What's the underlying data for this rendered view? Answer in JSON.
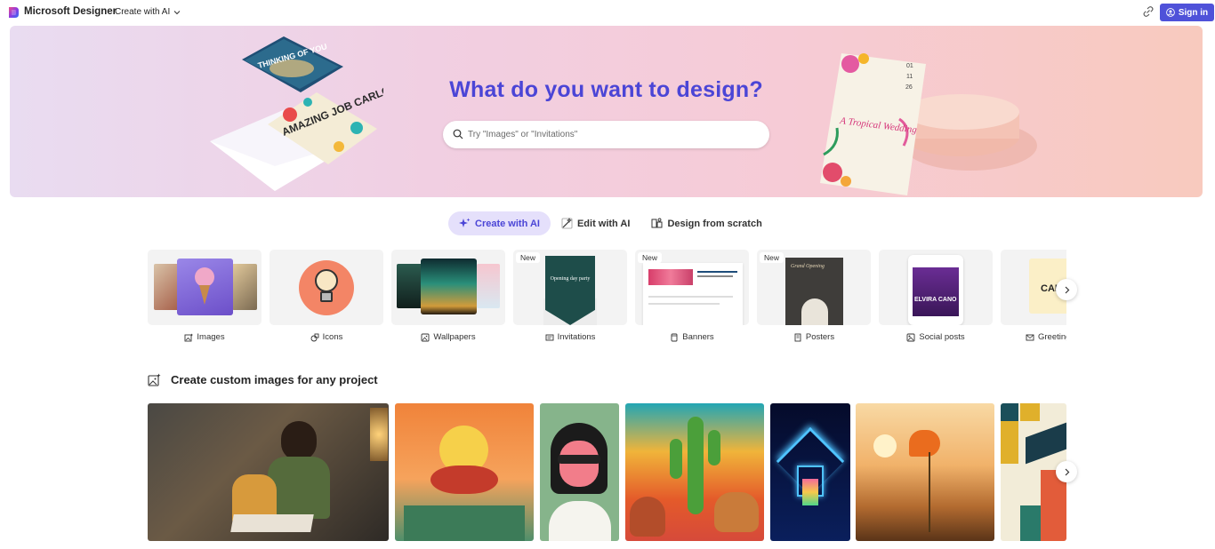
{
  "app": {
    "brand": "Microsoft Designer"
  },
  "header": {
    "create_menu_label": "Create with AI",
    "signin_label": "Sign in"
  },
  "hero": {
    "title": "What do you want to design?",
    "search_placeholder": "Try \"Images\" or \"Invitations\"",
    "card_text_1": "THINKING OF YOU",
    "card_text_2": "AMAZING JOB CARLOS",
    "invite_title": "A Tropical Wedding",
    "invite_date": [
      "01",
      "11",
      "26"
    ]
  },
  "mode_tabs": [
    {
      "label": "Create with AI",
      "icon": "sparkle-icon",
      "active": true
    },
    {
      "label": "Edit with AI",
      "icon": "magic-wand-icon",
      "active": false
    },
    {
      "label": "Design from scratch",
      "icon": "layout-icon",
      "active": false
    }
  ],
  "categories": [
    {
      "label": "Images",
      "icon": "image-sparkle-icon",
      "badge": ""
    },
    {
      "label": "Icons",
      "icon": "icon-shapes-icon",
      "badge": ""
    },
    {
      "label": "Wallpapers",
      "icon": "wallpaper-icon",
      "badge": ""
    },
    {
      "label": "Invitations",
      "icon": "invitation-icon",
      "badge": "New",
      "card_text": "Opening day party"
    },
    {
      "label": "Banners",
      "icon": "banner-icon",
      "badge": "New"
    },
    {
      "label": "Posters",
      "icon": "poster-icon",
      "badge": "New",
      "card_text": "Grand Opening"
    },
    {
      "label": "Social posts",
      "icon": "social-post-icon",
      "badge": "",
      "card_text": "ELVIRA CANO"
    },
    {
      "label": "Greeting",
      "icon": "greeting-card-icon",
      "badge": "",
      "card_text": "CAR"
    }
  ],
  "gallery_section": {
    "title": "Create custom images for any project"
  },
  "gallery": [
    {
      "subject": "mother-reading-to-child"
    },
    {
      "subject": "campfire-barbecue"
    },
    {
      "subject": "woman-with-sunglasses"
    },
    {
      "subject": "desert-cactus-pottery"
    },
    {
      "subject": "neon-house"
    },
    {
      "subject": "sunset-poppy-flower"
    },
    {
      "subject": "graduation-cap"
    }
  ],
  "colors": {
    "accent": "#4f52d9",
    "hero_title": "#4b45d6",
    "active_tab_bg": "#e5e0fb"
  }
}
